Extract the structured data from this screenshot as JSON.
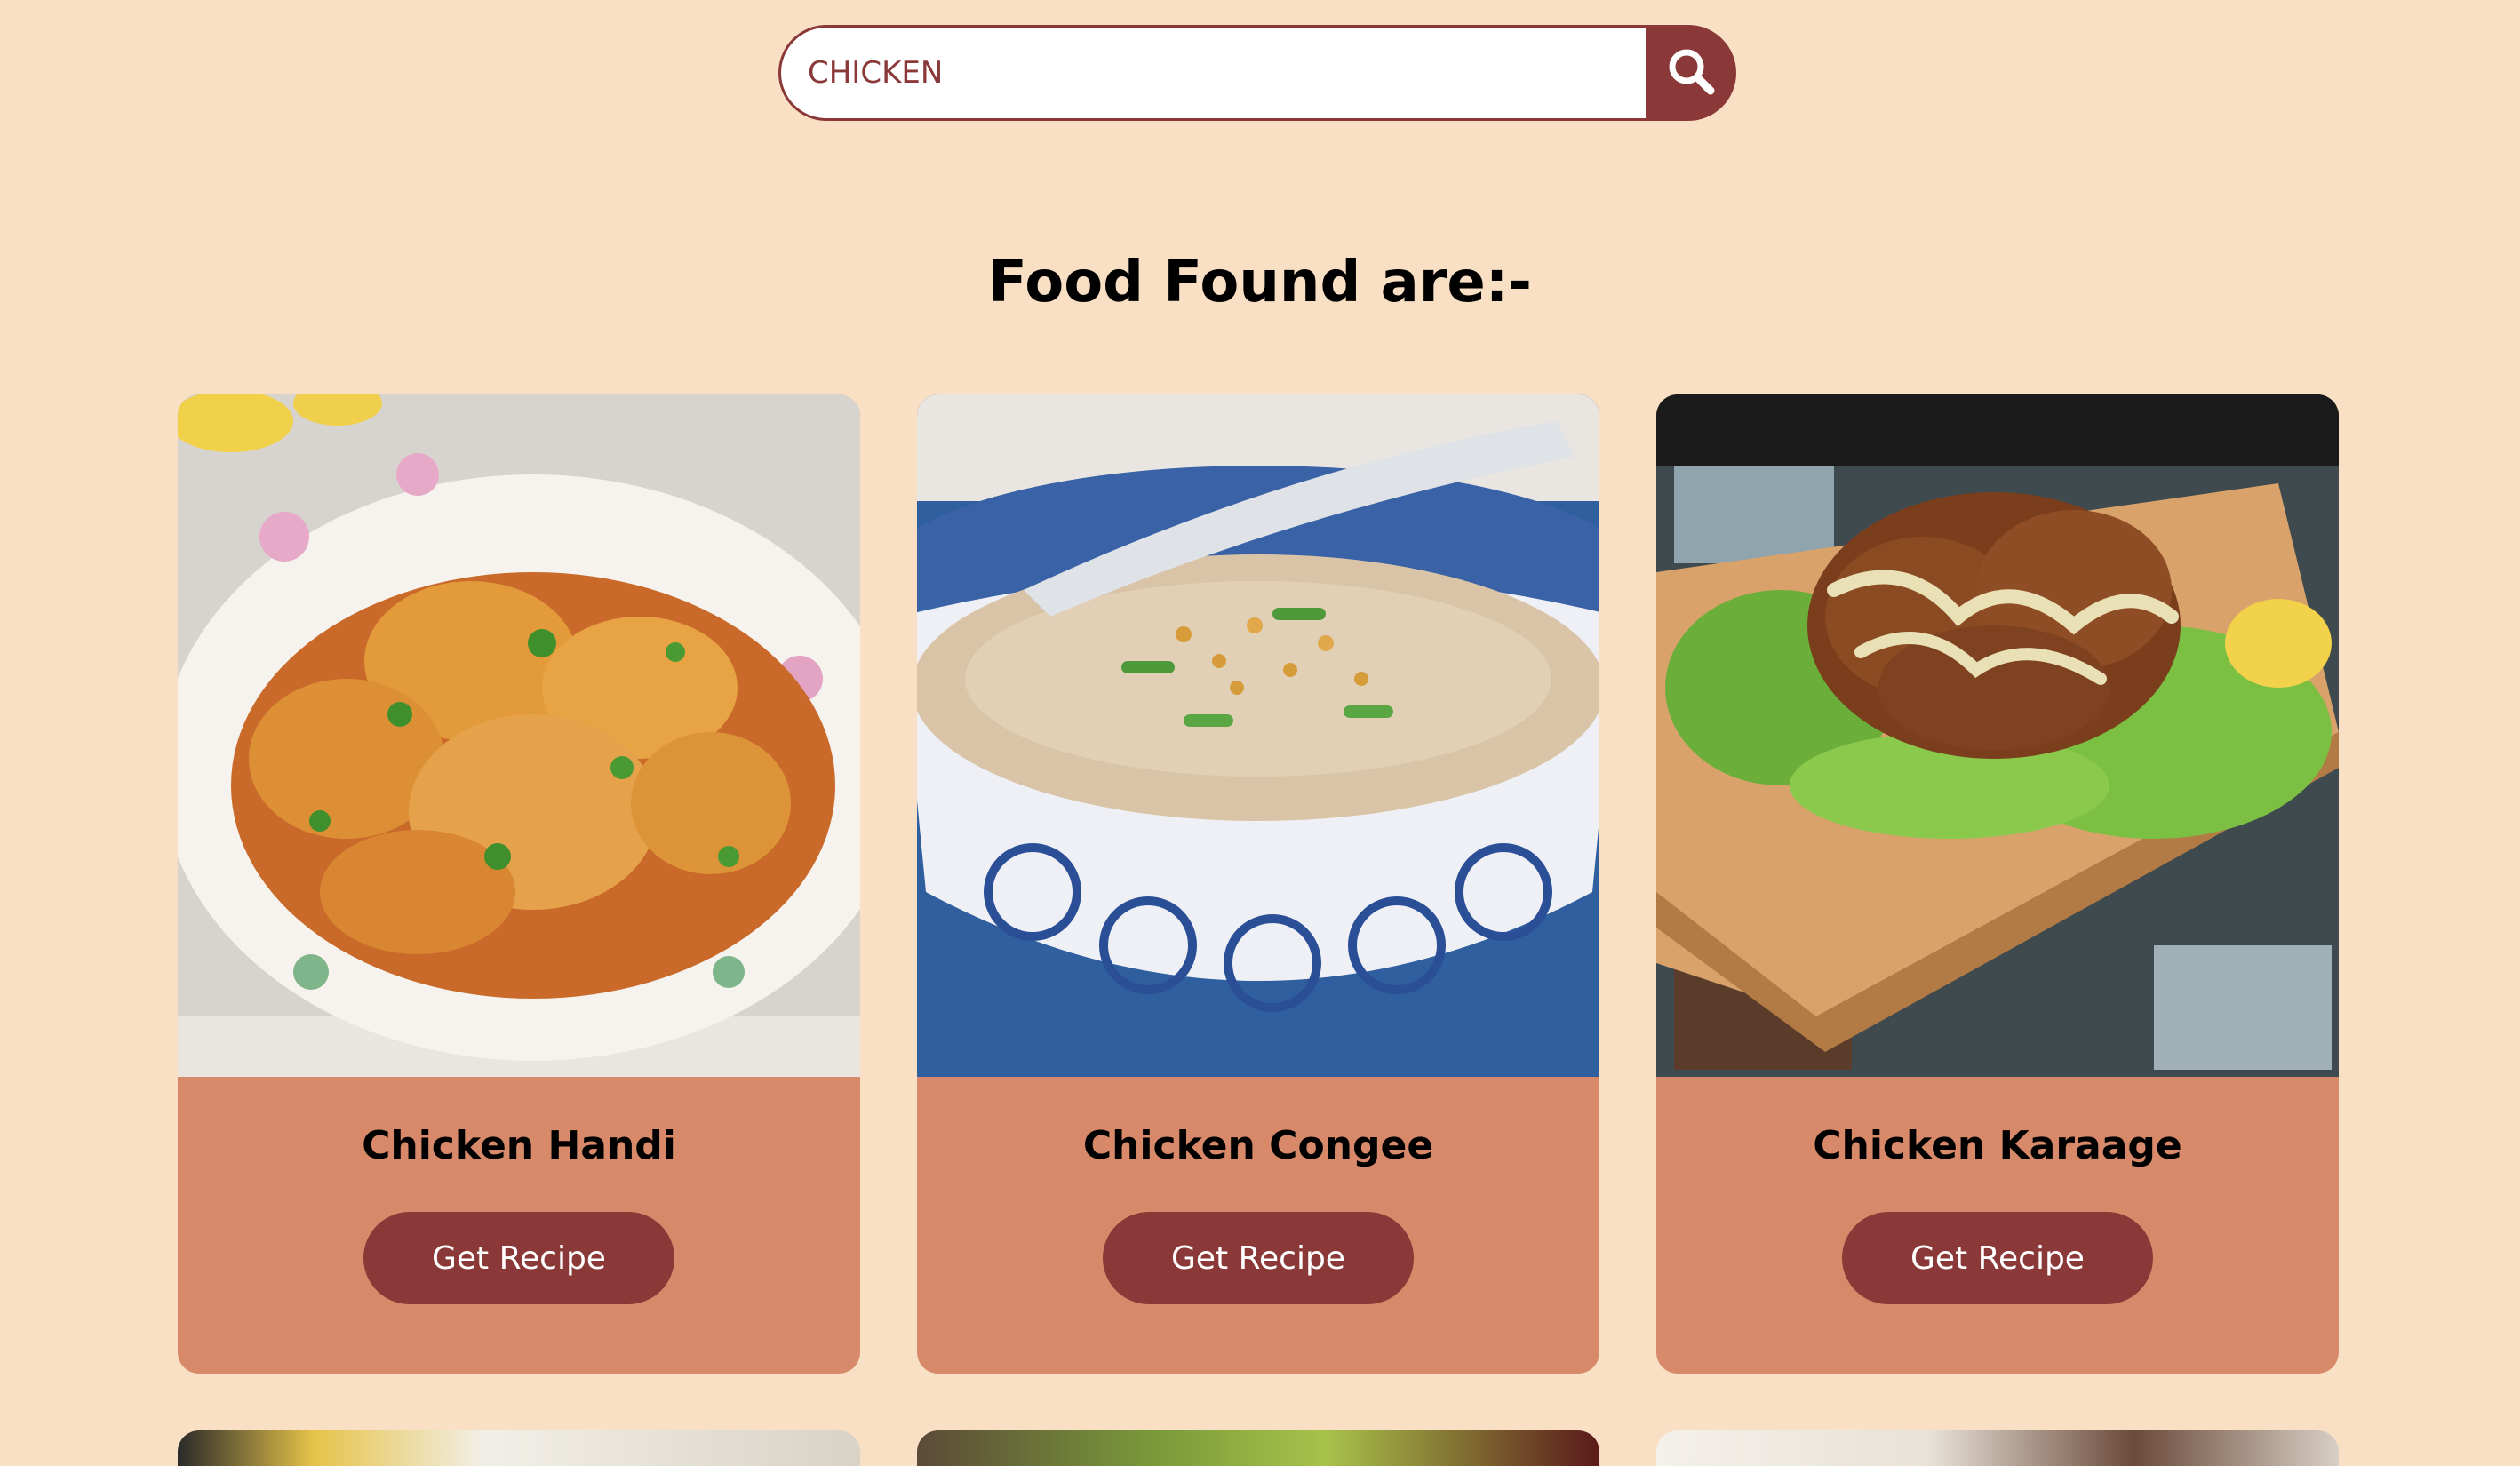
{
  "search": {
    "value": "CHICKEN",
    "button_icon": "search-icon"
  },
  "page": {
    "heading": "Food Found are:-"
  },
  "results": [
    {
      "title": "Chicken Handi",
      "button_label": "Get Recipe"
    },
    {
      "title": "Chicken Congee",
      "button_label": "Get Recipe"
    },
    {
      "title": "Chicken Karaage",
      "button_label": "Get Recipe"
    }
  ],
  "colors": {
    "background": "#f9dfc4",
    "accent": "#8a3838",
    "card": "#d8896a",
    "button_text": "#ffffff"
  }
}
